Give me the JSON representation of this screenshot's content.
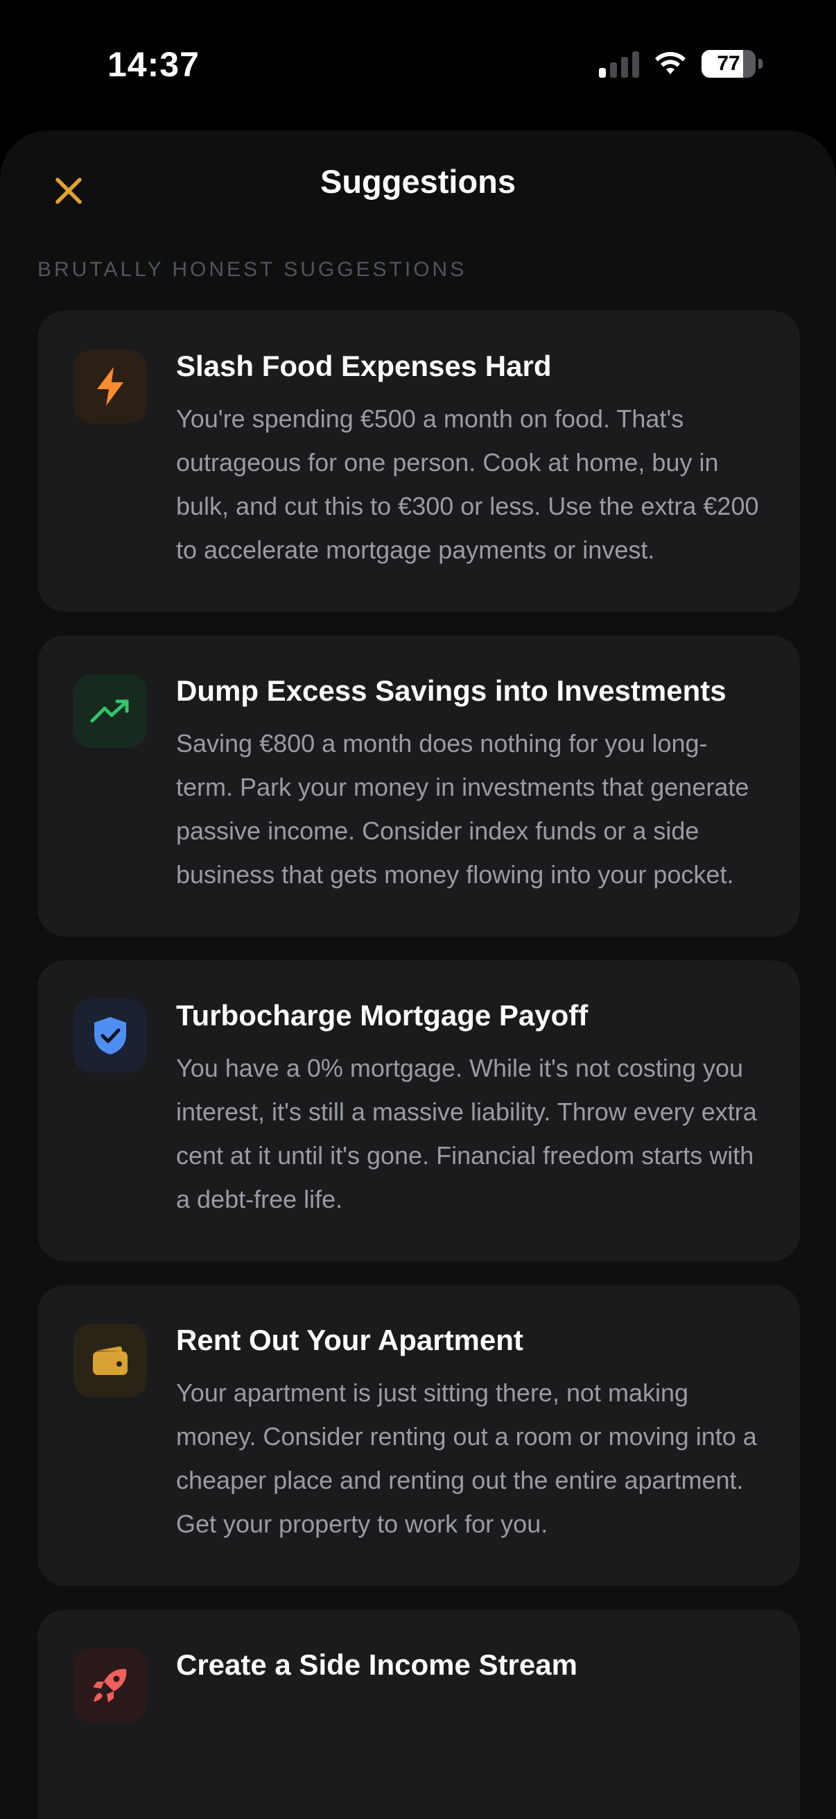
{
  "status_bar": {
    "time": "14:37",
    "battery_level": "77",
    "signal_bars_active": 1,
    "signal_bars_total": 4
  },
  "header": {
    "title": "Suggestions",
    "close_icon": "close-x-icon"
  },
  "section": {
    "label": "BRUTALLY HONEST SUGGESTIONS"
  },
  "colors": {
    "accent": "#e0a330",
    "background": "#0f0f10",
    "card": "#1b1b1d",
    "muted_text": "#9a9ca3"
  },
  "suggestions": [
    {
      "icon": "lightning-bolt-icon",
      "icon_color": "#ff8c2e",
      "icon_bg": "#2b2016",
      "title": "Slash Food Expenses Hard",
      "text": "You're spending €500 a month on food. That's outrageous for one person. Cook at home, buy in bulk, and cut this to €300 or less. Use the extra €200 to accelerate mortgage payments or invest."
    },
    {
      "icon": "trending-up-icon",
      "icon_color": "#34c46b",
      "icon_bg": "#172a1f",
      "title": "Dump Excess Savings into Investments",
      "text": "Saving €800 a month does nothing for you long-term. Park your money in investments that generate passive income. Consider index funds or a side business that gets money flowing into your pocket."
    },
    {
      "icon": "shield-check-icon",
      "icon_color": "#4f8ff2",
      "icon_bg": "#1a2130",
      "title": "Turbocharge Mortgage Payoff",
      "text": "You have a 0% mortgage. While it's not costing you interest, it's still a massive liability. Throw every extra cent at it until it's gone. Financial freedom starts with a debt-free life."
    },
    {
      "icon": "wallet-icon",
      "icon_color": "#d9a234",
      "icon_bg": "#2a2416",
      "title": "Rent Out Your Apartment",
      "text": "Your apartment is just sitting there, not making money. Consider renting out a room or moving into a cheaper place and renting out the entire apartment. Get your property to work for you."
    },
    {
      "icon": "rocket-icon",
      "icon_color": "#f0605c",
      "icon_bg": "#2c1a1b",
      "title": "Create a Side Income Stream",
      "text": ""
    }
  ]
}
